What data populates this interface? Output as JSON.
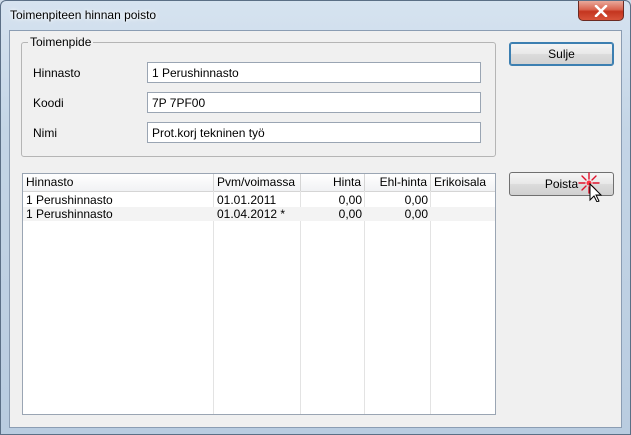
{
  "window": {
    "title": "Toimenpiteen hinnan poisto"
  },
  "group": {
    "legend": "Toimenpide",
    "fields": [
      {
        "label": "Hinnasto",
        "value": "1  Perushinnasto"
      },
      {
        "label": "Koodi",
        "value": "7P 7PF00"
      },
      {
        "label": "Nimi",
        "value": "Prot.korj tekninen työ"
      }
    ]
  },
  "buttons": {
    "close": "Sulje",
    "delete": "Poista"
  },
  "table": {
    "columns": [
      "Hinnasto",
      "Pvm/voimassa",
      "Hinta",
      "Ehl-hinta",
      "Erikoisala"
    ],
    "rows": [
      [
        "1  Perushinnasto",
        "01.01.2011",
        "0,00",
        "0,00",
        ""
      ],
      [
        "1  Perushinnasto",
        "01.04.2012 *",
        "0,00",
        "0,00",
        ""
      ]
    ]
  },
  "icons": {
    "close": "close-icon",
    "cursor": "mouse-pointer-icon"
  },
  "colors": {
    "close_button": "#c4351f",
    "default_button_border": "#3c7fb1"
  }
}
